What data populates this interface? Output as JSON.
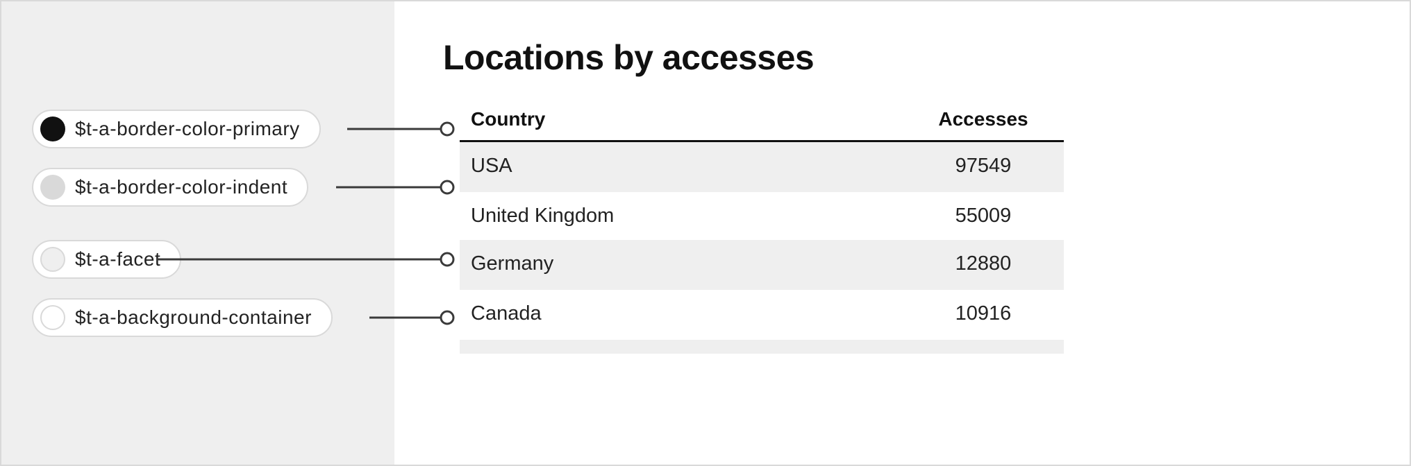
{
  "title": "Locations by accesses",
  "tokens": [
    {
      "label": "$t-a-border-color-primary"
    },
    {
      "label": "$t-a-border-color-indent"
    },
    {
      "label": "$t-a-facet"
    },
    {
      "label": "$t-a-background-container"
    }
  ],
  "table": {
    "columns": {
      "country": "Country",
      "accesses": "Accesses"
    },
    "rows": [
      {
        "country": "USA",
        "accesses": "97549"
      },
      {
        "country": "United Kingdom",
        "accesses": "55009"
      },
      {
        "country": "Germany",
        "accesses": "12880"
      },
      {
        "country": "Canada",
        "accesses": "10916"
      }
    ]
  }
}
